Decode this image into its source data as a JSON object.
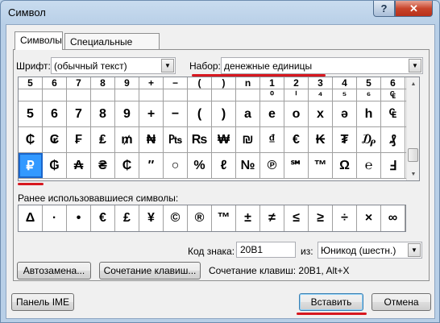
{
  "window": {
    "title": "Символ",
    "help": "?",
    "close": "✕"
  },
  "tabs": [
    {
      "label": "Символы",
      "active": true
    },
    {
      "label": "Специальные знаки",
      "active": false
    }
  ],
  "font": {
    "label": "Шрифт:",
    "value": "(обычный текст)"
  },
  "subset": {
    "label": "Набор:",
    "value": "денежные единицы"
  },
  "grid": {
    "rows": [
      [
        "5",
        "6",
        "7",
        "8",
        "9",
        "+",
        "−",
        "(",
        ")",
        "n",
        "1",
        "2",
        "3",
        "4",
        "5",
        "6"
      ],
      [
        "",
        "",
        "",
        "",
        "",
        "",
        "",
        "",
        "",
        "",
        "⁰",
        "ⁱ",
        "⁴",
        "⁵",
        "⁶",
        "₠"
      ],
      [
        "5",
        "6",
        "7",
        "8",
        "9",
        "+",
        "−",
        "(",
        ")",
        "a",
        "e",
        "o",
        "x",
        "ə",
        "h",
        "₠"
      ],
      [
        "₵",
        "₢",
        "₣",
        "₤",
        "₥",
        "₦",
        "₧",
        "₨",
        "₩",
        "₪",
        "₫",
        "€",
        "₭",
        "₮",
        "₯",
        "₰"
      ],
      [
        "₽",
        "₲",
        "₳",
        "₴",
        "₵",
        "″",
        "○",
        "%",
        "ℓ",
        "№",
        "℗",
        "℠",
        "™",
        "Ω",
        "℮",
        "Ⅎ"
      ]
    ],
    "selected_row": 4,
    "selected_col": 0
  },
  "recent": {
    "label": "Ранее использовавшиеся символы:",
    "items": [
      "Δ",
      "·",
      "•",
      "€",
      "£",
      "¥",
      "©",
      "®",
      "™",
      "±",
      "≠",
      "≤",
      "≥",
      "÷",
      "×",
      "∞"
    ]
  },
  "code": {
    "label": "Код знака:",
    "value": "20B1",
    "from_label": "из:",
    "from_value": "Юникод (шестн.)"
  },
  "buttons": {
    "autocorrect": "Автозамена...",
    "shortcut_key": "Сочетание клавиш...",
    "shortcut_text": "Сочетание клавиш: 20B1, Alt+X",
    "ime_panel": "Панель IME",
    "insert": "Вставить",
    "cancel": "Отмена"
  },
  "colors": {
    "highlight": "#d7171f",
    "selection": "#3399ff"
  }
}
